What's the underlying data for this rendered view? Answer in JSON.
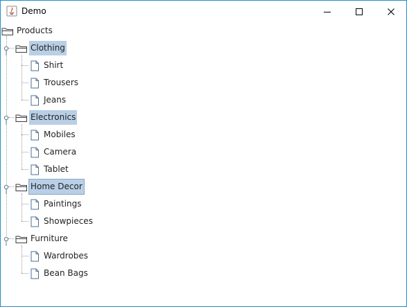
{
  "window": {
    "title": "Demo",
    "icon": "java-icon"
  },
  "controls": {
    "minimize": "minimize-icon",
    "maximize": "maximize-icon",
    "close": "close-icon"
  },
  "tree": {
    "root": "Products",
    "categories": [
      {
        "label": "Clothing",
        "selected": true,
        "items": [
          "Shirt",
          "Trousers",
          "Jeans"
        ]
      },
      {
        "label": "Electronics",
        "selected": true,
        "items": [
          "Mobiles",
          "Camera",
          "Tablet"
        ]
      },
      {
        "label": "Home Decor",
        "selected": true,
        "focused": true,
        "items": [
          "Paintings",
          "Showpieces"
        ]
      },
      {
        "label": "Furniture",
        "selected": false,
        "items": [
          "Wardrobes",
          "Bean Bags"
        ]
      }
    ]
  },
  "colors": {
    "selection": "#b8cfe5",
    "window_border": "#1f8fcf"
  }
}
